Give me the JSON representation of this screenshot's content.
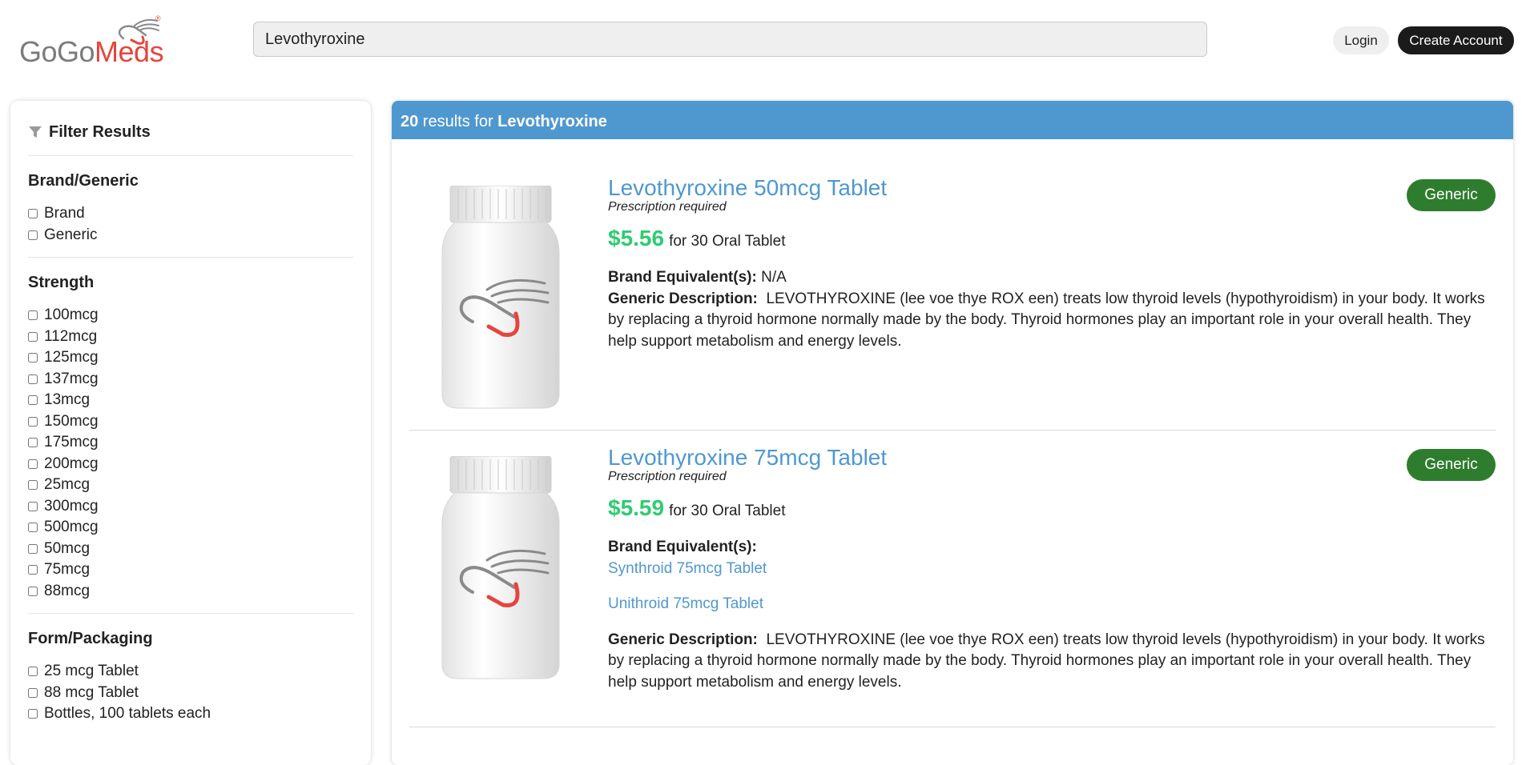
{
  "brand": {
    "logo_part1": "GoGo",
    "logo_part2": "Meds",
    "reg_mark": "®"
  },
  "search": {
    "value": "Levothyroxine"
  },
  "header": {
    "login_label": "Login",
    "create_account_label": "Create Account"
  },
  "filters": {
    "title": "Filter Results",
    "groups": [
      {
        "title": "Brand/Generic",
        "options": [
          "Brand",
          "Generic"
        ]
      },
      {
        "title": "Strength",
        "options": [
          "100mcg",
          "112mcg",
          "125mcg",
          "137mcg",
          "13mcg",
          "150mcg",
          "175mcg",
          "200mcg",
          "25mcg",
          "300mcg",
          "500mcg",
          "50mcg",
          "75mcg",
          "88mcg"
        ]
      },
      {
        "title": "Form/Packaging",
        "options": [
          "25 mcg Tablet",
          "88 mcg Tablet",
          "Bottles, 100 tablets each"
        ]
      }
    ]
  },
  "results": {
    "count": "20",
    "text_mid": " results for ",
    "query": "Levothyroxine",
    "items": [
      {
        "name": "Levothyroxine 50mcg Tablet",
        "rx": "Prescription required",
        "price": "$5.56",
        "qty": "for 30 Oral Tablet",
        "brand_equiv_label": "Brand Equivalent(s):",
        "brand_equiv_value": " N/A",
        "generic_desc_label": "Generic Description:",
        "generic_desc": "  LEVOTHYROXINE (lee voe thye ROX een) treats low thyroid levels (hypothyroidism) in your body. It works by replacing a thyroid hormone normally made by the body. Thyroid hormones play an important role in your overall health. They help support metabolism and energy levels.",
        "badge": "Generic"
      },
      {
        "name": "Levothyroxine 75mcg Tablet",
        "rx": "Prescription required",
        "price": "$5.59",
        "qty": "for 30 Oral Tablet",
        "brand_equiv_label": "Brand Equivalent(s):",
        "brand_links": [
          "Synthroid 75mcg Tablet",
          "Unithroid 75mcg Tablet"
        ],
        "generic_desc_label": "Generic Description:",
        "generic_desc": "  LEVOTHYROXINE (lee voe thye ROX een) treats low thyroid levels (hypothyroidism) in your body. It works by replacing a thyroid hormone normally made by the body. Thyroid hormones play an important role in your overall health. They help support metabolism and energy levels.",
        "badge": "Generic"
      }
    ]
  },
  "colors": {
    "accent": "#4f98cf",
    "price": "#2ecc71",
    "badge": "#2e7d2e",
    "logo_red": "#e5453d"
  }
}
